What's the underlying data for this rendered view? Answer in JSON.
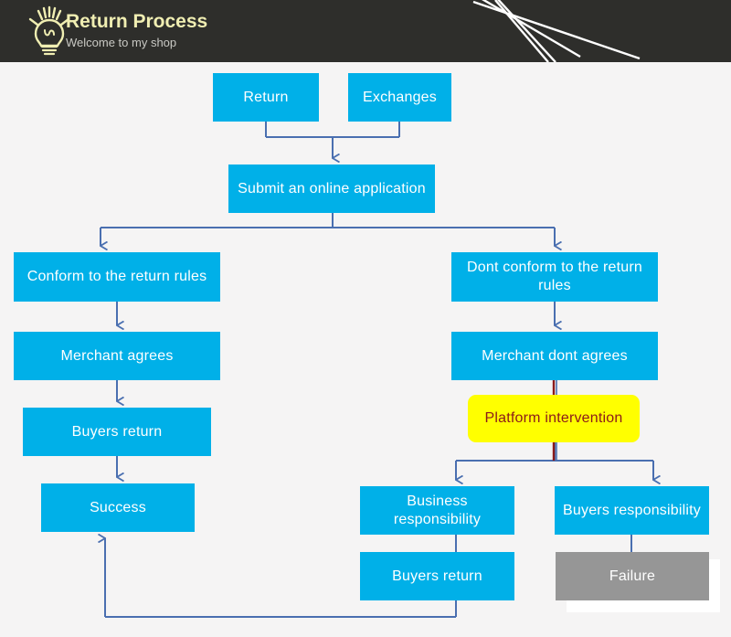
{
  "header": {
    "title": "Return Process",
    "subtitle": "Welcome to my shop",
    "icon": "lightbulb-icon",
    "background_color": "#2e2e2b",
    "title_color": "#f0eeb2",
    "subtitle_color": "#c9c9c4",
    "decoration": "white-diagonal-lines"
  },
  "colors": {
    "canvas_background": "#f5f4f4",
    "node_blue": "#00b0e8",
    "node_gray": "#969696",
    "node_yellow": "#ffff00",
    "yellow_text": "#8b1a1a",
    "connector_blue": "#4a6fb0",
    "connector_red": "#8b1a1a"
  },
  "chart_data": {
    "type": "diagram",
    "title": "Return Process",
    "nodes": [
      {
        "id": "return",
        "label": "Return",
        "style": "blue"
      },
      {
        "id": "exchanges",
        "label": "Exchanges",
        "style": "blue"
      },
      {
        "id": "submit",
        "label": "Submit an online application",
        "style": "blue"
      },
      {
        "id": "conform",
        "label": "Conform to the return rules",
        "style": "blue"
      },
      {
        "id": "dont-conform",
        "label": "Dont conform to the return rules",
        "style": "blue"
      },
      {
        "id": "merchant-agrees",
        "label": "Merchant agrees",
        "style": "blue"
      },
      {
        "id": "merchant-dont",
        "label": "Merchant dont agrees",
        "style": "blue"
      },
      {
        "id": "buyers-return-left",
        "label": "Buyers return",
        "style": "blue"
      },
      {
        "id": "platform",
        "label": "Platform intervention",
        "style": "yellow"
      },
      {
        "id": "success",
        "label": "Success",
        "style": "blue"
      },
      {
        "id": "business-resp",
        "label": "Business responsibility",
        "style": "blue"
      },
      {
        "id": "buyers-resp",
        "label": "Buyers responsibility",
        "style": "blue"
      },
      {
        "id": "buyers-return-right",
        "label": "Buyers return",
        "style": "blue"
      },
      {
        "id": "failure",
        "label": "Failure",
        "style": "gray"
      }
    ],
    "edges": [
      {
        "from": "return",
        "to": "submit"
      },
      {
        "from": "exchanges",
        "to": "submit"
      },
      {
        "from": "submit",
        "to": "conform"
      },
      {
        "from": "submit",
        "to": "dont-conform"
      },
      {
        "from": "conform",
        "to": "merchant-agrees"
      },
      {
        "from": "merchant-agrees",
        "to": "buyers-return-left"
      },
      {
        "from": "buyers-return-left",
        "to": "success"
      },
      {
        "from": "dont-conform",
        "to": "merchant-dont"
      },
      {
        "from": "merchant-dont",
        "to": "platform"
      },
      {
        "from": "platform",
        "to": "business-resp"
      },
      {
        "from": "platform",
        "to": "buyers-resp"
      },
      {
        "from": "business-resp",
        "to": "buyers-return-right"
      },
      {
        "from": "buyers-resp",
        "to": "failure"
      },
      {
        "from": "buyers-return-right",
        "to": "success"
      }
    ]
  },
  "nodes": {
    "return": "Return",
    "exchanges": "Exchanges",
    "submit": "Submit an online application",
    "conform": "Conform to the return rules",
    "dont_conform": "Dont conform to the return rules",
    "merchant_agrees": "Merchant agrees",
    "merchant_dont_agrees": "Merchant dont agrees",
    "buyers_return_left": "Buyers return",
    "platform_intervention": "Platform intervention",
    "success": "Success",
    "business_responsibility": "Business responsibility",
    "buyers_responsibility": "Buyers responsibility",
    "buyers_return_right": "Buyers return",
    "failure": "Failure"
  }
}
